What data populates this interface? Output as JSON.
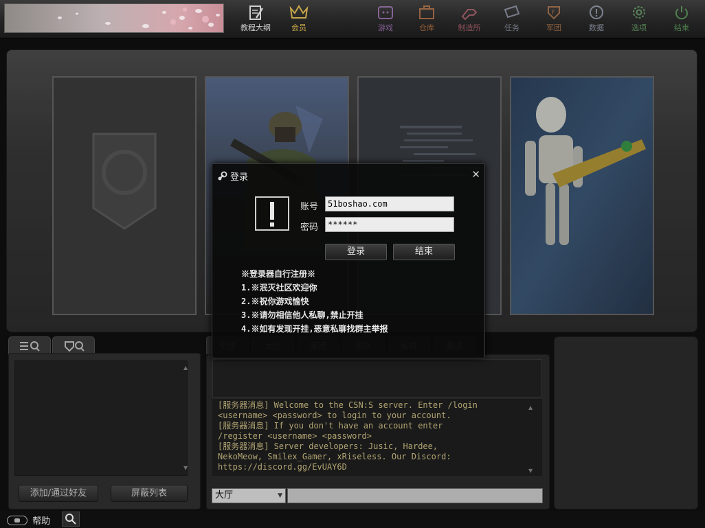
{
  "nav": [
    {
      "label": "教程大纲",
      "icon": "tutorial-icon",
      "color": "#cfcfcf"
    },
    {
      "label": "会员",
      "icon": "crown-icon",
      "color": "#c8a84a"
    },
    {
      "label": "游戏",
      "icon": "game-icon",
      "color": "#b070c8"
    },
    {
      "label": "仓库",
      "icon": "inventory-icon",
      "color": "#d07840"
    },
    {
      "label": "制造所",
      "icon": "workshop-icon",
      "color": "#b86070"
    },
    {
      "label": "任务",
      "icon": "mission-icon",
      "color": "#9aa0b8"
    },
    {
      "label": "军团",
      "icon": "clan-icon",
      "color": "#c07848"
    },
    {
      "label": "数据",
      "icon": "data-icon",
      "color": "#a0a8c0"
    },
    {
      "label": "选项",
      "icon": "options-icon",
      "color": "#68a868"
    },
    {
      "label": "结束",
      "icon": "power-icon",
      "color": "#58a858"
    }
  ],
  "friends": {
    "tabs": [
      "friend-list-icon",
      "clan-members-icon"
    ],
    "add_button": "添加/通过好友",
    "block_button": "屏蔽列表"
  },
  "chat": {
    "tabs": [
      "全部",
      "大厅",
      "军团",
      "组队",
      "私信",
      "频道"
    ],
    "log": [
      "[服务器消息] Welcome to the CSN:S server. Enter /login",
      "<username> <password> to login to your account.",
      "[服务器消息] If you don't have an account enter",
      "/register <username> <password>",
      "[服务器消息] Server developers: Jusic, Hardee,",
      "NekoMeow, Smilex_Gamer, xRiseless. Our Discord:",
      "https://discord.gg/EvUAY6D"
    ],
    "channel": "大厅"
  },
  "bottom": {
    "help": "帮助"
  },
  "login": {
    "title": "登录",
    "account_label": "账号",
    "account_value": "51boshao.com",
    "password_label": "密码",
    "password_value": "******",
    "login_button": "登录",
    "exit_button": "结束",
    "notice": [
      "※登录器自行注册※",
      "1.※泯灭社区欢迎你",
      "2.※祝你游戏愉快",
      "3.※请勿相信他人私聊,禁止开挂",
      "4.※如有发现开挂,恶意私聊找群主举报"
    ]
  }
}
